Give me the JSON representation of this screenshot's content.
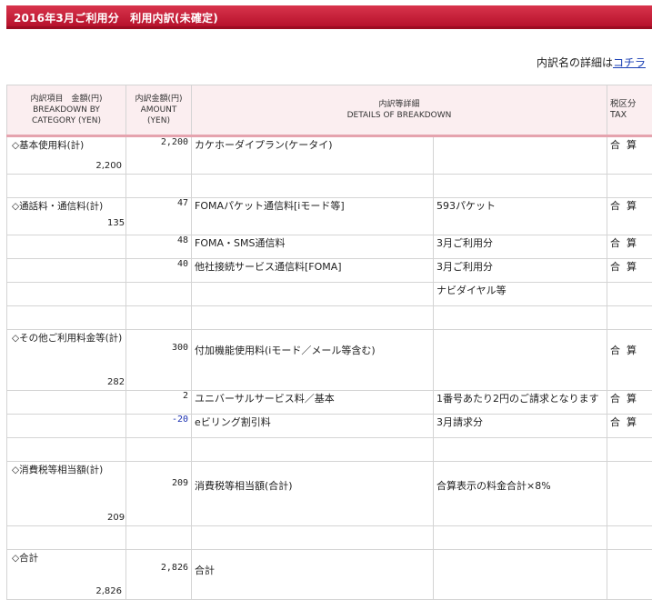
{
  "header": {
    "title": "2016年3月ご利用分　利用内訳(未確定)"
  },
  "detail_note": {
    "text": "内訳名の詳細は",
    "link": "コチラ"
  },
  "table": {
    "headers": {
      "category": [
        "内訳項目　金額(円)",
        "BREAKDOWN BY",
        "CATEGORY (YEN)"
      ],
      "amount": [
        "内訳金額(円)",
        "AMOUNT",
        "(YEN)"
      ],
      "details": [
        "内訳等詳細",
        "DETAILS OF BREAKDOWN"
      ],
      "tax": [
        "税区分",
        "TAX"
      ]
    },
    "sections": [
      {
        "category": "◇基本使用料(計)",
        "total": "2,200",
        "rows": [
          {
            "amount": "2,200",
            "desc": "カケホーダイプラン(ケータイ)",
            "desc2": "",
            "tax": "合算",
            "neg": false
          }
        ]
      },
      {
        "category": "◇通話料・通信料(計)",
        "total": "135",
        "rows": [
          {
            "amount": "47",
            "desc": "FOMAパケット通信料[iモード等]",
            "desc2": "593パケット",
            "tax": "合算",
            "neg": false
          },
          {
            "amount": "48",
            "desc": "FOMA・SMS通信料",
            "desc2": "3月ご利用分",
            "tax": "合算",
            "neg": false
          },
          {
            "amount": "40",
            "desc": "他社接続サービス通信料[FOMA]",
            "desc2": "3月ご利用分",
            "tax": "合算",
            "neg": false
          },
          {
            "amount": "",
            "desc": "",
            "desc2": "ナビダイヤル等",
            "tax": "",
            "neg": false
          }
        ]
      },
      {
        "category": "◇その他ご利用料金等(計)",
        "total": "282",
        "rows": [
          {
            "amount": "300",
            "desc": "付加機能使用料(iモード／メール等含む)",
            "desc2": "",
            "tax": "合算",
            "neg": false
          },
          {
            "amount": "2",
            "desc": "ユニバーサルサービス料／基本",
            "desc2": "1番号あたり2円のご請求となります",
            "tax": "合算",
            "neg": false
          },
          {
            "amount": "-20",
            "desc": "eビリング割引料",
            "desc2": "3月請求分",
            "tax": "合算",
            "neg": true
          }
        ]
      },
      {
        "category": "◇消費税等相当額(計)",
        "total": "209",
        "rows": [
          {
            "amount": "209",
            "desc": "消費税等相当額(合計)",
            "desc2": "合算表示の料金合計×8%",
            "tax": "",
            "neg": false
          }
        ]
      },
      {
        "category": "◇合計",
        "total": "2,826",
        "rows": [
          {
            "amount": "2,826",
            "desc": "合計",
            "desc2": "",
            "tax": "",
            "neg": false
          }
        ]
      }
    ]
  }
}
